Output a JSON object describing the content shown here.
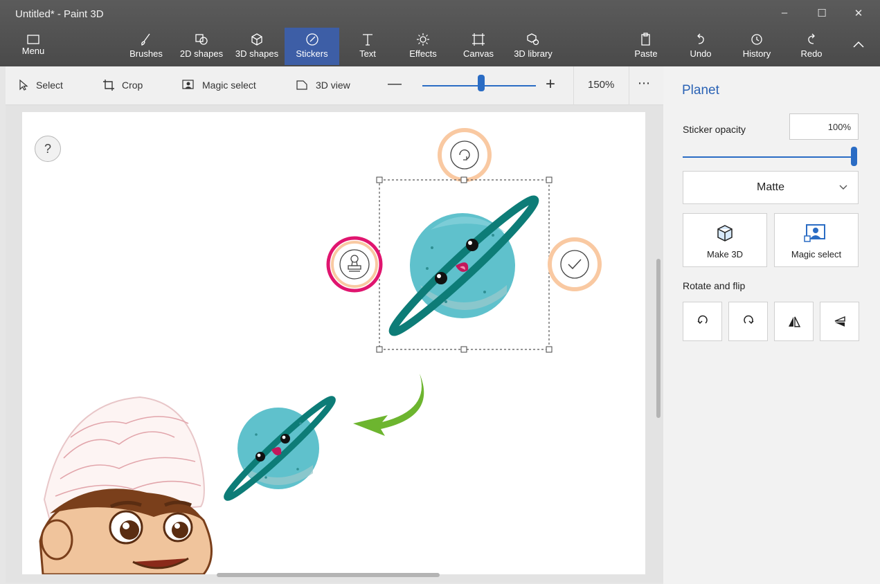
{
  "window": {
    "title": "Untitled* - Paint 3D",
    "minimize": "–",
    "maximize": "☐",
    "close": "✕"
  },
  "ribbon": {
    "menu": "Menu",
    "brushes": "Brushes",
    "shapes2d": "2D shapes",
    "shapes3d": "3D shapes",
    "stickers": "Stickers",
    "text": "Text",
    "effects": "Effects",
    "canvas": "Canvas",
    "library3d": "3D library",
    "paste": "Paste",
    "undo": "Undo",
    "history": "History",
    "redo": "Redo",
    "collapse": "^"
  },
  "toolbar": {
    "select": "Select",
    "crop": "Crop",
    "magic_select": "Magic select",
    "view3d": "3D view",
    "zoom_out": "—",
    "zoom_in": "+",
    "zoom_level": "150%",
    "zoom_fraction": 0.52,
    "more": "⋯"
  },
  "canvas": {
    "help": "?"
  },
  "panel": {
    "title": "Planet",
    "opacity_label": "Sticker opacity",
    "opacity_value": "100%",
    "opacity_fraction": 1.0,
    "finish": "Matte",
    "make3d": "Make 3D",
    "magic_select": "Magic select",
    "rotate_flip": "Rotate and flip"
  },
  "colors": {
    "accent": "#2a6cc4",
    "ribbon": "#4a4a4a",
    "highlight_ring": "#e0156f",
    "soft_ring": "#f9c9a2",
    "planet": "#5fc1cc",
    "planet_ring": "#0d7c77",
    "arrow": "#6db52f"
  }
}
